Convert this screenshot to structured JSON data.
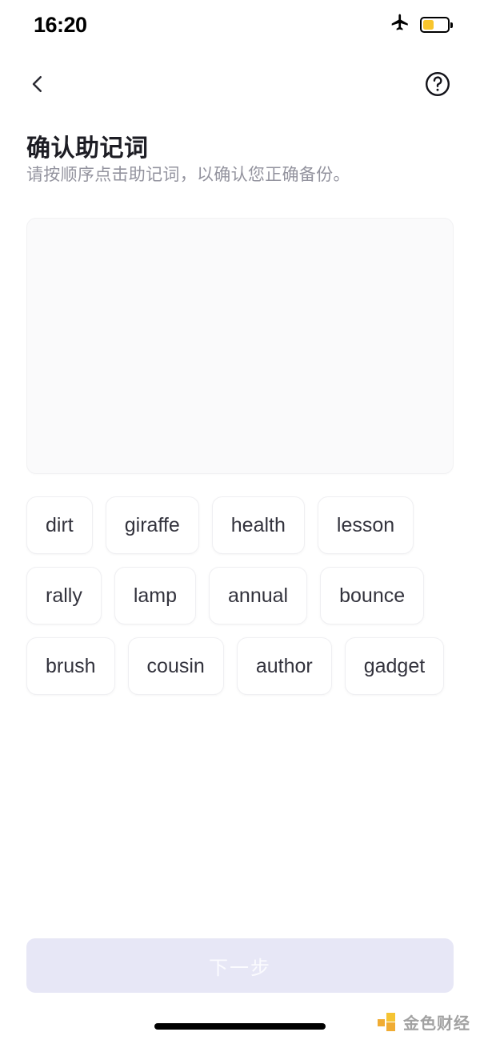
{
  "status_bar": {
    "time": "16:20",
    "airplane_icon": "airplane-mode-icon",
    "battery_icon": "battery-low-power-icon",
    "battery_level_percent": 46,
    "battery_fill_color": "#f8c52c"
  },
  "nav": {
    "back_icon": "chevron-left-icon",
    "help_icon": "help-circle-icon"
  },
  "header": {
    "title": "确认助记词",
    "subtitle": "请按顺序点击助记词，以确认您正确备份。"
  },
  "dropzone": {
    "selected_words": [],
    "placeholder": ""
  },
  "word_bank": {
    "words": [
      "dirt",
      "giraffe",
      "health",
      "lesson",
      "rally",
      "lamp",
      "annual",
      "bounce",
      "brush",
      "cousin",
      "author",
      "gadget"
    ]
  },
  "footer": {
    "next_label": "下一步",
    "next_enabled": false,
    "next_bg_color": "#e7e7f6",
    "next_text_color": "#fbfbfe"
  },
  "watermark": {
    "text": "金色财经",
    "logo_icon": "jinse-logo-icon",
    "logo_colors": [
      "#f5c22b",
      "#f0a92b"
    ]
  }
}
